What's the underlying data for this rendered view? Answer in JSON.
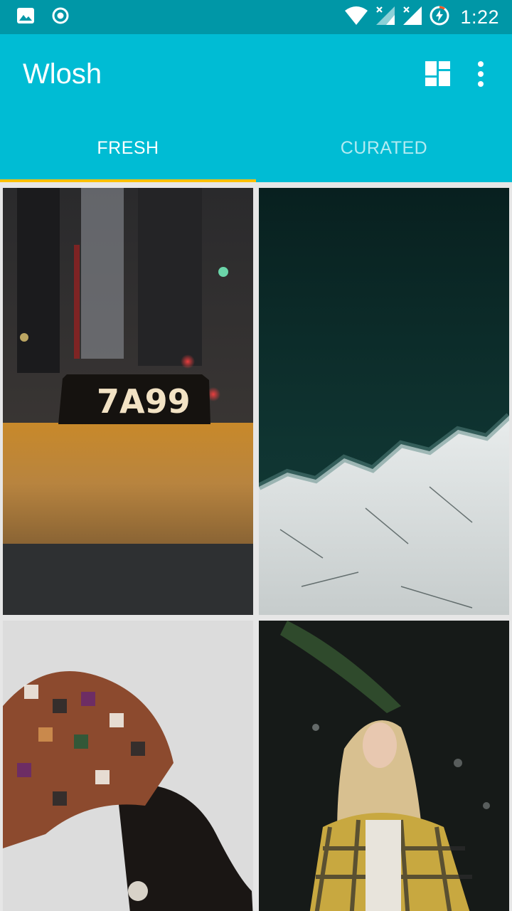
{
  "status_bar": {
    "time": "1:22",
    "icons": [
      "gallery-icon",
      "record-icon",
      "wifi-icon",
      "signal-no-sim-icon",
      "signal-no-sim-icon",
      "battery-charging-icon"
    ]
  },
  "app_bar": {
    "title": "Wlosh",
    "actions": [
      "dashboard-layout-icon",
      "more-vert-icon"
    ]
  },
  "tabs": [
    {
      "label": "FRESH",
      "active": true
    },
    {
      "label": "CURATED",
      "active": false
    }
  ],
  "photos": [
    {
      "subject": "taxi-roof-sign",
      "sign_text": "7A99"
    },
    {
      "subject": "aerial-ice-and-water"
    },
    {
      "subject": "woman-in-headwrap"
    },
    {
      "subject": "woman-in-plaid-coat"
    }
  ],
  "colors": {
    "status_bar": "#0097a7",
    "app_bar": "#00bcd4",
    "tab_indicator": "#ffc107",
    "background": "#e6e6e6"
  }
}
